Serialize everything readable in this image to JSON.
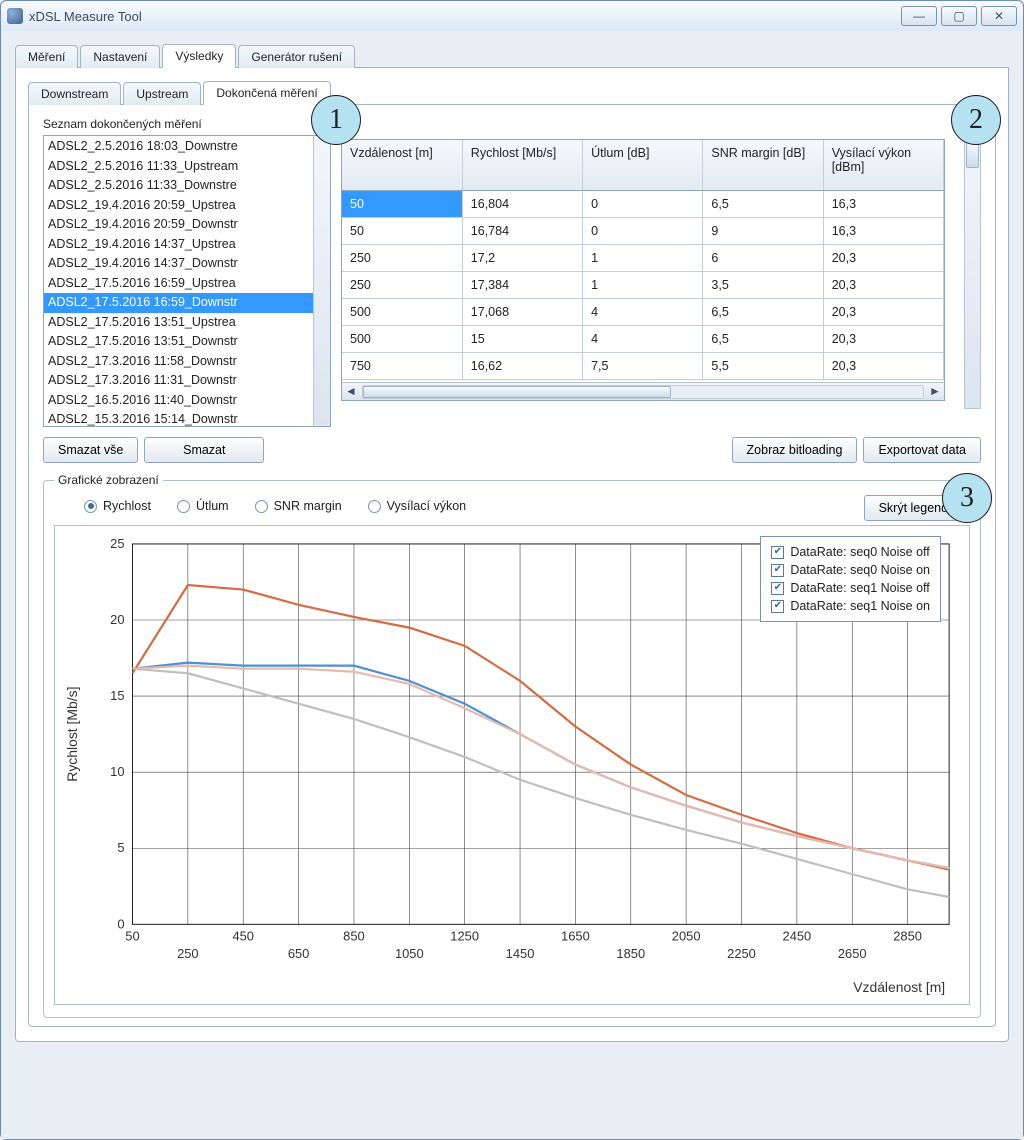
{
  "window": {
    "title": "xDSL Measure Tool"
  },
  "mainTabs": [
    "Měření",
    "Nastavení",
    "Výsledky",
    "Generátor rušení"
  ],
  "subTabs": [
    "Downstream",
    "Upstream",
    "Dokončená měření"
  ],
  "listCaption": "Seznam dokončených měření",
  "listItems": [
    "ADSL2_2.5.2016 18:03_Downstre",
    "ADSL2_2.5.2016 11:33_Upstream",
    "ADSL2_2.5.2016 11:33_Downstre",
    "ADSL2_19.4.2016 20:59_Upstrea",
    "ADSL2_19.4.2016 20:59_Downstr",
    "ADSL2_19.4.2016 14:37_Upstrea",
    "ADSL2_19.4.2016 14:37_Downstr",
    "ADSL2_17.5.2016 16:59_Upstrea",
    "ADSL2_17.5.2016 16:59_Downstr",
    "ADSL2_17.5.2016 13:51_Upstrea",
    "ADSL2_17.5.2016 13:51_Downstr",
    "ADSL2_17.3.2016 11:58_Downstr",
    "ADSL2_17.3.2016 11:31_Downstr",
    "ADSL2_16.5.2016 11:40_Downstr",
    "ADSL2_15.3.2016 15:14_Downstr"
  ],
  "listSelectedIndex": 8,
  "table": {
    "headers": [
      "Vzdálenost [m]",
      "Rychlost [Mb/s]",
      "Útlum [dB]",
      "SNR margin [dB]",
      "Vysílací výkon [dBm]"
    ],
    "rows": [
      [
        "50",
        "16,804",
        "0",
        "6,5",
        "16,3"
      ],
      [
        "50",
        "16,784",
        "0",
        "9",
        "16,3"
      ],
      [
        "250",
        "17,2",
        "1",
        "6",
        "20,3"
      ],
      [
        "250",
        "17,384",
        "1",
        "3,5",
        "20,3"
      ],
      [
        "500",
        "17,068",
        "4",
        "6,5",
        "20,3"
      ],
      [
        "500",
        "15",
        "4",
        "6,5",
        "20,3"
      ],
      [
        "750",
        "16,62",
        "7,5",
        "5,5",
        "20,3"
      ]
    ],
    "selectedRow": 0
  },
  "buttons": {
    "deleteAll": "Smazat vše",
    "delete": "Smazat",
    "showBitloading": "Zobraz bitloading",
    "exportData": "Exportovat data",
    "hideLegend": "Skrýt legendu"
  },
  "groupTitle": "Grafické zobrazení",
  "radios": [
    "Rychlost",
    "Útlum",
    "SNR margin",
    "Vysílací výkon"
  ],
  "radioSelected": 0,
  "legendItems": [
    "DataRate: seq0 Noise off",
    "DataRate: seq0 Noise on",
    "DataRate: seq1 Noise off",
    "DataRate: seq1 Noise on"
  ],
  "badges": {
    "one": "1",
    "two": "2",
    "three": "3"
  },
  "chart_data": {
    "type": "line",
    "title": "",
    "xlabel": "Vzdálenost [m]",
    "ylabel": "Rychlost [Mb/s]",
    "xlim": [
      50,
      3000
    ],
    "ylim": [
      0,
      25
    ],
    "xticks": [
      50,
      250,
      450,
      650,
      850,
      1050,
      1250,
      1450,
      1650,
      1850,
      2050,
      2250,
      2450,
      2650,
      2850
    ],
    "yticks": [
      0,
      5,
      10,
      15,
      20,
      25
    ],
    "x": [
      50,
      250,
      450,
      650,
      850,
      1050,
      1250,
      1450,
      1650,
      1850,
      2050,
      2250,
      2450,
      2650,
      2850,
      3000
    ],
    "series": [
      {
        "name": "DataRate: seq0 Noise off",
        "color": "#4a90d9",
        "values": [
          16.8,
          17.2,
          17.0,
          17.0,
          17.0,
          16.0,
          14.5,
          12.5,
          10.5,
          9.0,
          7.8,
          6.7,
          5.8,
          5.0,
          4.2,
          3.7
        ]
      },
      {
        "name": "DataRate: seq0 Noise on",
        "color": "#bfbfbf",
        "values": [
          16.8,
          16.5,
          15.5,
          14.5,
          13.5,
          12.3,
          11.0,
          9.5,
          8.3,
          7.2,
          6.2,
          5.3,
          4.3,
          3.3,
          2.3,
          1.8
        ]
      },
      {
        "name": "DataRate: seq1 Noise off",
        "color": "#d66b3f",
        "values": [
          16.5,
          22.3,
          22.0,
          21.0,
          20.2,
          19.5,
          18.3,
          16.0,
          13.0,
          10.5,
          8.5,
          7.2,
          6.0,
          5.0,
          4.2,
          3.6
        ]
      },
      {
        "name": "DataRate: seq1 Noise on",
        "color": "#e8b8aa",
        "values": [
          16.8,
          17.0,
          16.8,
          16.8,
          16.6,
          15.8,
          14.2,
          12.5,
          10.5,
          9.0,
          7.8,
          6.7,
          5.8,
          5.0,
          4.2,
          3.7
        ]
      }
    ]
  }
}
